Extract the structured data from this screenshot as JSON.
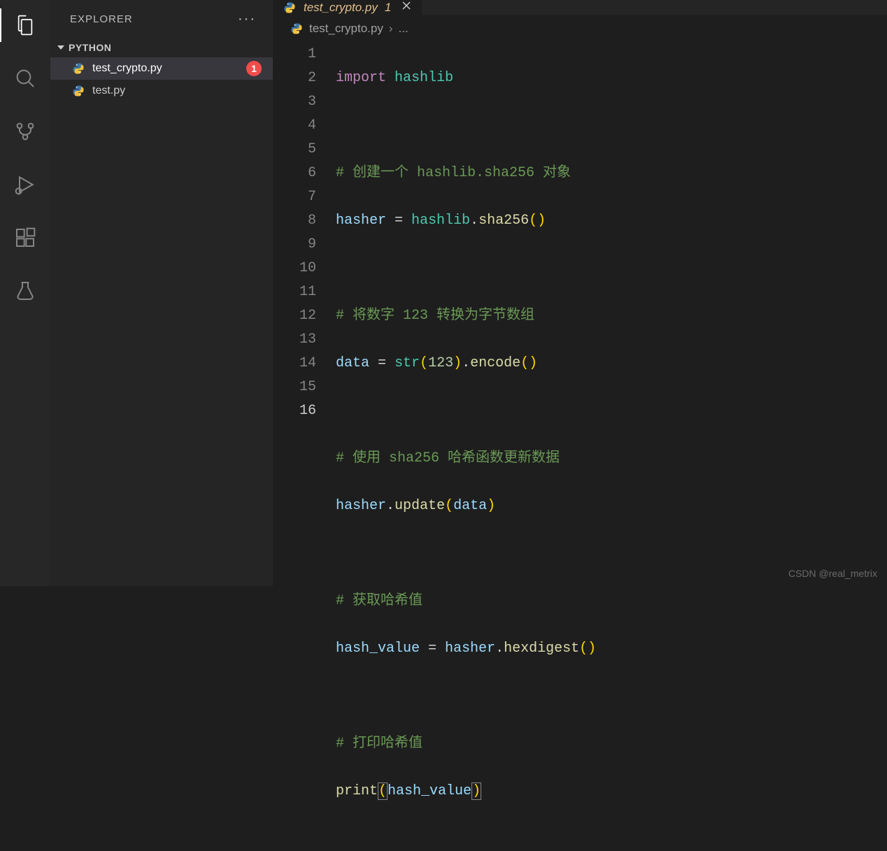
{
  "activity": {
    "items": [
      "explorer",
      "search",
      "source-control",
      "run-debug",
      "extensions",
      "testing"
    ]
  },
  "sidebar": {
    "title": "EXPLORER",
    "folder": "PYTHON",
    "files": [
      {
        "name": "test_crypto.py",
        "active": true,
        "badge": "1"
      },
      {
        "name": "test.py",
        "active": false
      }
    ]
  },
  "tab": {
    "filename": "test_crypto.py",
    "modified_indicator": "1"
  },
  "breadcrumb": {
    "file": "test_crypto.py",
    "rest": "..."
  },
  "code": {
    "lines": [
      {
        "n": "1",
        "t": "code"
      },
      {
        "n": "2",
        "t": "blank"
      },
      {
        "n": "3",
        "t": "comment",
        "text": "# 创建一个 hashlib.sha256 对象"
      },
      {
        "n": "4",
        "t": "code"
      },
      {
        "n": "5",
        "t": "blank"
      },
      {
        "n": "6",
        "t": "comment",
        "text": "# 将数字 123 转换为字节数组"
      },
      {
        "n": "7",
        "t": "code"
      },
      {
        "n": "8",
        "t": "blank"
      },
      {
        "n": "9",
        "t": "comment",
        "text": "# 使用 sha256 哈希函数更新数据"
      },
      {
        "n": "10",
        "t": "code"
      },
      {
        "n": "11",
        "t": "blank"
      },
      {
        "n": "12",
        "t": "comment",
        "text": "# 获取哈希值"
      },
      {
        "n": "13",
        "t": "code"
      },
      {
        "n": "14",
        "t": "blank"
      },
      {
        "n": "15",
        "t": "comment",
        "text": "# 打印哈希值"
      },
      {
        "n": "16",
        "t": "code"
      }
    ],
    "tokens": {
      "import": "import",
      "hashlib": "hashlib",
      "hasher": "hasher",
      "eq": " = ",
      "dot": ".",
      "sha256": "sha256",
      "lpar": "(",
      "rpar": ")",
      "data": "data",
      "str": "str",
      "num123": "123",
      "encode": "encode",
      "update": "update",
      "hash_value": "hash_value",
      "hexdigest": "hexdigest",
      "print": "print"
    }
  },
  "watermark": "CSDN @real_metrix"
}
